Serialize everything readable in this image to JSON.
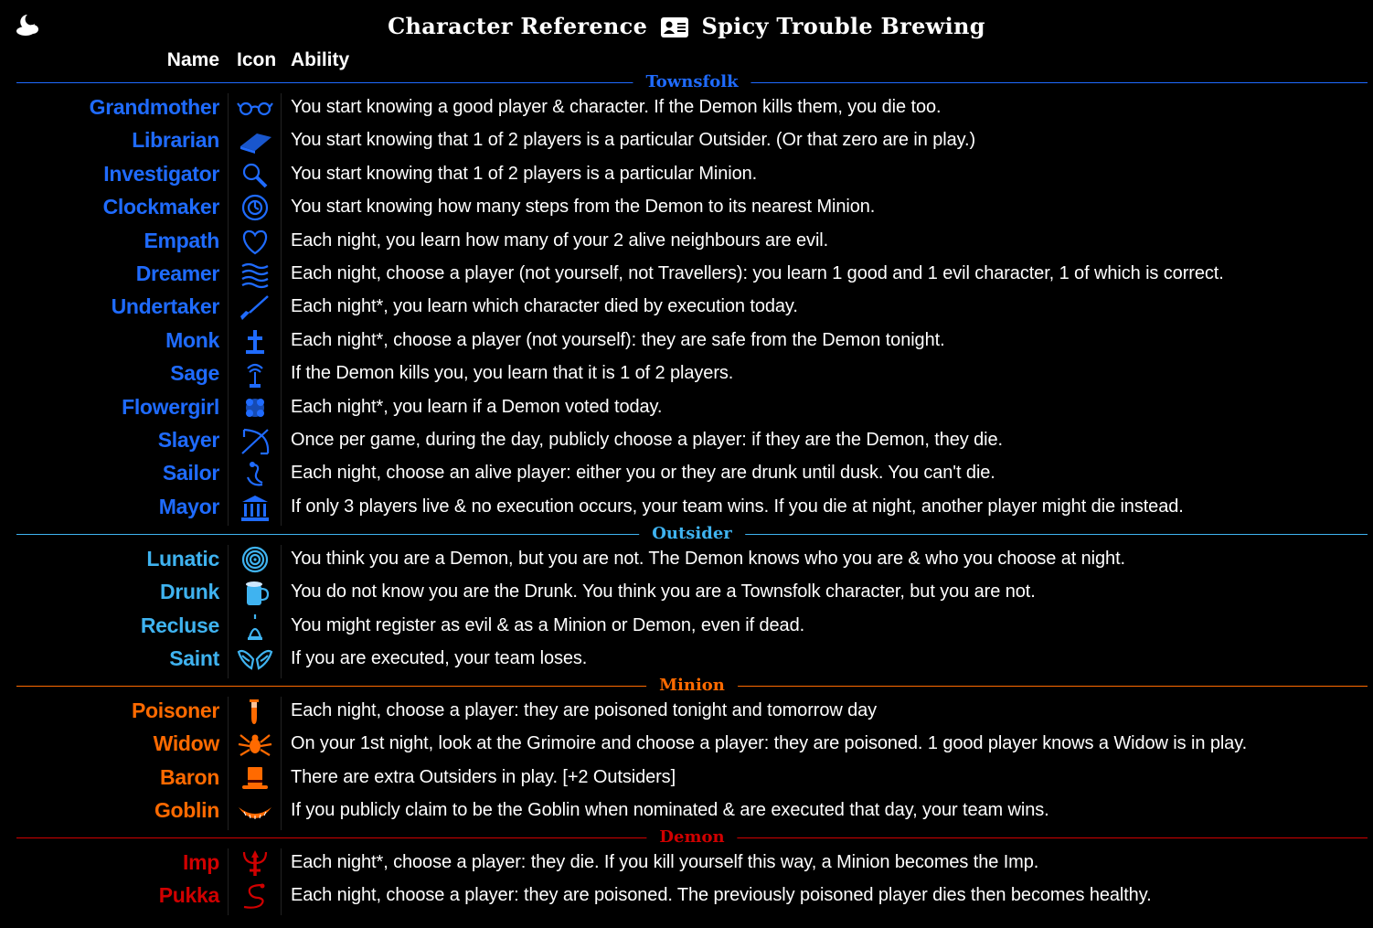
{
  "header": {
    "title_left": "Character Reference",
    "title_right": "Spicy Trouble Brewing",
    "corner_icon": "moon-cloud-icon",
    "title_icon": "id-card-icon"
  },
  "columns": {
    "name": "Name",
    "icon": "Icon",
    "ability": "Ability"
  },
  "colors": {
    "townsfolk": "#1f6bff",
    "outsider": "#3fb3f0",
    "minion": "#ff6a00",
    "demon": "#d00000"
  },
  "sections": [
    {
      "label": "Townsfolk",
      "rows": [
        {
          "name": "Grandmother",
          "icon": "glasses-icon",
          "ability": "You start knowing a good player & character. If the Demon kills them, you die too."
        },
        {
          "name": "Librarian",
          "icon": "book-icon",
          "ability": "You start knowing that 1 of 2 players is a particular Outsider. (Or that zero are in play.)"
        },
        {
          "name": "Investigator",
          "icon": "magnifier-icon",
          "ability": "You start knowing that 1 of 2 players is a particular Minion."
        },
        {
          "name": "Clockmaker",
          "icon": "clock-icon",
          "ability": "You start knowing how many steps from the Demon to its nearest Minion."
        },
        {
          "name": "Empath",
          "icon": "heart-icon",
          "ability": "Each night, you learn how many of your 2 alive neighbours are evil."
        },
        {
          "name": "Dreamer",
          "icon": "waves-icon",
          "ability": "Each night, choose a player (not yourself, not Travellers): you learn 1 good and 1 evil character, 1 of which is correct."
        },
        {
          "name": "Undertaker",
          "icon": "shovel-icon",
          "ability": "Each night*, you learn which character died by execution today."
        },
        {
          "name": "Monk",
          "icon": "cross-icon",
          "ability": "Each night*, choose a player (not yourself): they are safe from the Demon tonight."
        },
        {
          "name": "Sage",
          "icon": "sage-tree-icon",
          "ability": "If the Demon kills you, you learn that it is 1 of 2 players."
        },
        {
          "name": "Flowergirl",
          "icon": "flower-icon",
          "ability": "Each night*, you learn if a Demon voted today."
        },
        {
          "name": "Slayer",
          "icon": "bow-icon",
          "ability": "Once per game, during the day, publicly choose a player: if they are the Demon, they die."
        },
        {
          "name": "Sailor",
          "icon": "anchor-icon",
          "ability": "Each night, choose an alive player: either you or they are drunk until dusk. You can't die."
        },
        {
          "name": "Mayor",
          "icon": "building-icon",
          "ability": "If only 3 players live & no execution occurs, your team wins. If you die at night, another player might die instead."
        }
      ]
    },
    {
      "label": "Outsider",
      "rows": [
        {
          "name": "Lunatic",
          "icon": "spiral-icon",
          "ability": "You think you are a Demon, but you are not. The Demon knows who you are & who you choose at night."
        },
        {
          "name": "Drunk",
          "icon": "mug-icon",
          "ability": "You do not know you are the Drunk. You think you are a Townsfolk character, but you are not."
        },
        {
          "name": "Recluse",
          "icon": "lantern-icon",
          "ability": "You might register as evil & as a Minion or Demon, even if dead."
        },
        {
          "name": "Saint",
          "icon": "wings-icon",
          "ability": "If you are executed, your team loses."
        }
      ]
    },
    {
      "label": "Minion",
      "rows": [
        {
          "name": "Poisoner",
          "icon": "vial-icon",
          "ability": "Each night, choose a player: they are poisoned tonight and tomorrow day"
        },
        {
          "name": "Widow",
          "icon": "spider-icon",
          "ability": "On your 1st night, look at the Grimoire and choose a player: they are poisoned. 1 good player knows a Widow is in play."
        },
        {
          "name": "Baron",
          "icon": "top-hat-icon",
          "ability": "There are extra Outsiders in play. [+2 Outsiders]"
        },
        {
          "name": "Goblin",
          "icon": "grin-icon",
          "ability": "If you publicly claim to be the Goblin when nominated & are executed that day, your team wins."
        }
      ]
    },
    {
      "label": "Demon",
      "rows": [
        {
          "name": "Imp",
          "icon": "trident-icon",
          "ability": "Each night*, choose a player: they die. If you kill yourself this way, a Minion becomes the Imp."
        },
        {
          "name": "Pukka",
          "icon": "snake-icon",
          "ability": "Each night, choose a player: they are poisoned. The previously poisoned player dies then becomes healthy."
        }
      ]
    }
  ]
}
